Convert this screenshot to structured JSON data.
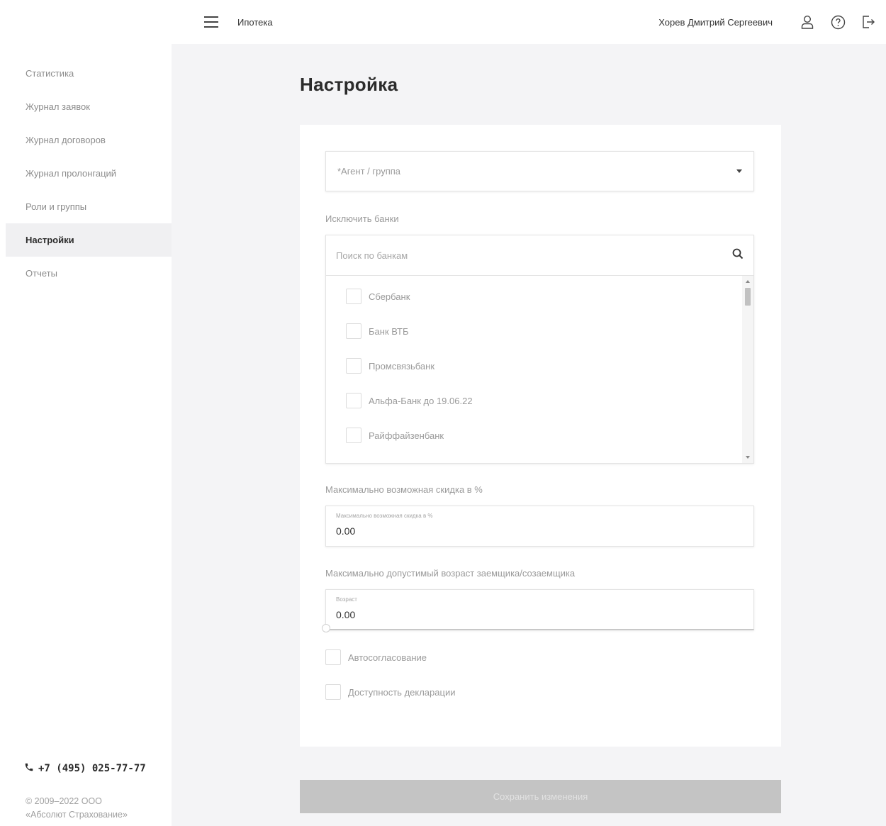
{
  "header": {
    "app_title": "Ипотека",
    "user_name": "Хорев Дмитрий Сергеевич"
  },
  "sidebar": {
    "items": [
      {
        "label": "Статистика"
      },
      {
        "label": "Журнал заявок"
      },
      {
        "label": "Журнал договоров"
      },
      {
        "label": "Журнал пролонгаций"
      },
      {
        "label": "Роли и группы"
      },
      {
        "label": "Настройки",
        "active": true
      },
      {
        "label": "Отчеты"
      }
    ],
    "phone": "+7 (495) 025-77-77",
    "copyright_line1": "© 2009–2022 ООО",
    "copyright_line2": "«Абсолют Страхование»"
  },
  "page": {
    "title": "Настройка"
  },
  "form": {
    "agent_select_placeholder": "*Агент / группа",
    "exclude_banks_label": "Исключить банки",
    "bank_search_placeholder": "Поиск по банкам",
    "banks": [
      {
        "label": "Сбербанк",
        "checked": false
      },
      {
        "label": "Банк ВТБ",
        "checked": false
      },
      {
        "label": "Промсвязьбанк",
        "checked": false
      },
      {
        "label": "Альфа-Банк до 19.06.22",
        "checked": false
      },
      {
        "label": "Райффайзенбанк",
        "checked": false
      }
    ],
    "discount_section_label": "Максимально возможная скидка в %",
    "discount_field_label": "Максимально возможная скидка в %",
    "discount_value": "0.00",
    "age_section_label": "Максимально допустимый возраст заемщика/созаемщика",
    "age_field_label": "Возраст",
    "age_value": "0.00",
    "auto_approval_label": "Автосогласование",
    "auto_approval_checked": false,
    "declaration_label": "Доступность декларации",
    "declaration_checked": false,
    "save_label": "Сохранить изменения"
  },
  "icons": {
    "menu": "menu-icon",
    "user": "user-icon",
    "help": "help-icon",
    "logout": "logout-icon",
    "search": "search-icon",
    "phone": "phone-icon"
  },
  "colors": {
    "sidebar_active_bg": "#f0f0f2",
    "page_bg": "#f4f4f6",
    "button_disabled": "#c4c4c4"
  }
}
